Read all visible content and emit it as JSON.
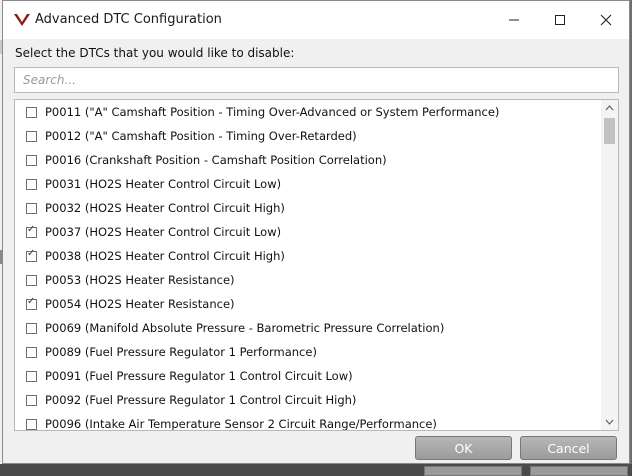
{
  "window": {
    "title": "Advanced DTC Configuration",
    "icons": {
      "app": "vehicle-v-logo-icon",
      "minimize": "minimize-icon",
      "maximize": "maximize-icon",
      "close": "close-icon"
    }
  },
  "dialog": {
    "instruction": "Select the DTCs that you would like to disable:",
    "search_placeholder": "Search...",
    "items": [
      {
        "label": "P0011 (\"A\" Camshaft Position - Timing Over-Advanced or System Performance)",
        "checked": false
      },
      {
        "label": "P0012 (\"A\" Camshaft Position - Timing Over-Retarded)",
        "checked": false
      },
      {
        "label": "P0016 (Crankshaft Position - Camshaft Position Correlation)",
        "checked": false
      },
      {
        "label": "P0031 (HO2S Heater Control Circuit Low)",
        "checked": false
      },
      {
        "label": "P0032 (HO2S Heater Control Circuit High)",
        "checked": false
      },
      {
        "label": "P0037 (HO2S Heater Control Circuit Low)",
        "checked": true
      },
      {
        "label": "P0038 (HO2S Heater Control Circuit High)",
        "checked": true
      },
      {
        "label": "P0053 (HO2S Heater Resistance)",
        "checked": false
      },
      {
        "label": "P0054 (HO2S Heater Resistance)",
        "checked": true
      },
      {
        "label": "P0069 (Manifold Absolute Pressure - Barometric Pressure Correlation)",
        "checked": false
      },
      {
        "label": "P0089 (Fuel Pressure Regulator 1 Performance)",
        "checked": false
      },
      {
        "label": "P0091 (Fuel Pressure Regulator 1 Control Circuit Low)",
        "checked": false
      },
      {
        "label": "P0092 (Fuel Pressure Regulator 1 Control Circuit High)",
        "checked": false
      },
      {
        "label": "P0096 (Intake Air Temperature Sensor 2 Circuit Range/Performance)",
        "checked": false
      }
    ],
    "ok_label": "OK",
    "cancel_label": "Cancel"
  },
  "colors": {
    "logo": "#8b1a1a",
    "button": "#a9a9a9"
  }
}
